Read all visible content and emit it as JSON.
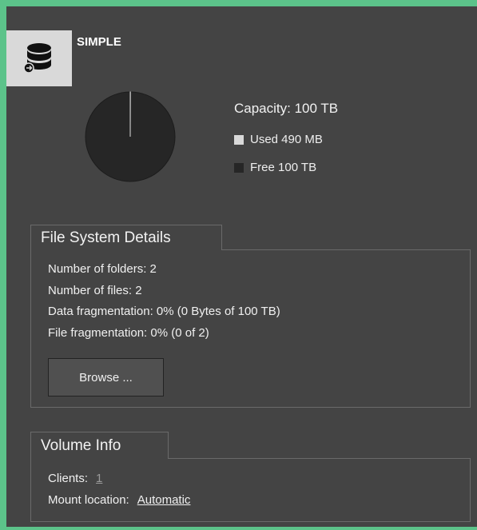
{
  "header": {
    "title": "SIMPLE",
    "icon": "database-icon"
  },
  "chart_data": {
    "type": "pie",
    "categories": [
      "Used 490 MB",
      "Free 100 TB"
    ],
    "values": [
      490,
      99999510
    ],
    "colors": [
      "#d9d9d9",
      "#262626"
    ]
  },
  "capacity": {
    "label": "Capacity: 100 TB",
    "used_label": "Used 490 MB",
    "free_label": "Free 100 TB",
    "used_color": "#d9d9d9",
    "free_color": "#262626"
  },
  "file_system": {
    "title": "File System Details",
    "folders": "Number of folders: 2",
    "files": "Number of files: 2",
    "data_frag": "Data fragmentation: 0% (0 Bytes of 100 TB)",
    "file_frag": "File fragmentation: 0% (0 of 2)",
    "browse_label": "Browse ..."
  },
  "volume_info": {
    "title": "Volume Info",
    "clients_label": "Clients:",
    "clients_value": "1",
    "mount_label": "Mount location:",
    "mount_value": "Automatic"
  }
}
